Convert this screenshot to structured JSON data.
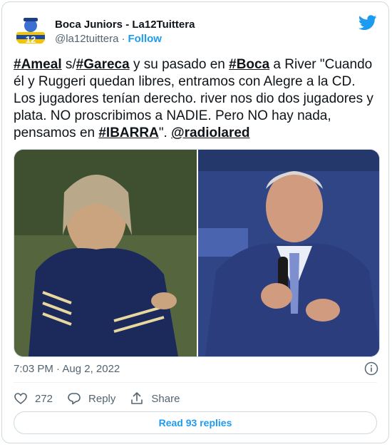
{
  "header": {
    "display_name": "Boca Juniors - La12Tuittera",
    "handle": "@la12tuittera",
    "separator": "·",
    "follow_label": "Follow",
    "avatar_text": "12"
  },
  "tweet": {
    "hashtag_ameal": "#Ameal",
    "text_1": " s/",
    "hashtag_gareca": "#Gareca",
    "text_2": " y su pasado en ",
    "hashtag_boca": "#Boca",
    "text_3": " a River \"Cuando él y Ruggeri quedan libres, entramos con Alegre a la CD. Los jugadores tenían derecho. river nos dio dos jugadores y plata. NO proscribimos a NADIE. Pero NO hay nada, pensamos en ",
    "hashtag_ibarra": "#IBARRA",
    "text_4": "\". ",
    "mention": "@radiolared"
  },
  "meta": {
    "timestamp": "7:03 PM · Aug 2, 2022"
  },
  "actions": {
    "likes": "272",
    "reply_label": "Reply",
    "share_label": "Share"
  },
  "footer": {
    "read_replies": "Read 93 replies"
  },
  "colors": {
    "accent": "#1d9bf0",
    "muted": "#536471",
    "border": "#cfd9de",
    "text": "#0f1419"
  }
}
